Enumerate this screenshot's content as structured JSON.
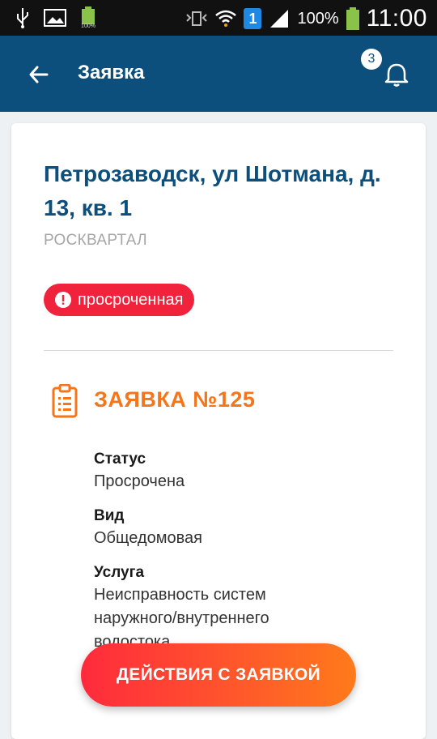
{
  "status_bar": {
    "usb_icon": "usb-icon",
    "image_icon": "image-icon",
    "battery_small_label": "100%",
    "signal_badge": "1",
    "battery_percent": "100%",
    "time": "11:00"
  },
  "app_bar": {
    "title": "Заявка",
    "notification_count": "3",
    "colors": {
      "background": "#0c4f7c"
    }
  },
  "card": {
    "address": "Петрозаводск, ул Шотмана, д. 13, кв. 1",
    "organization": "РОСКВАРТАЛ",
    "status_badge": "просроченная",
    "request_title": "ЗАЯВКА №125",
    "fields": [
      {
        "label": "Статус",
        "value": "Просрочена"
      },
      {
        "label": "Вид",
        "value": "Общедомовая"
      },
      {
        "label": "Услуга",
        "value": "Неисправность систем наружного/внутреннего водостока"
      }
    ]
  },
  "action_button": {
    "label": "ДЕЙСТВИЯ С ЗАЯВКОЙ"
  },
  "colors": {
    "accent_orange": "#f4761b",
    "badge_red": "#f0223c",
    "primary_blue": "#0c4f7c"
  }
}
